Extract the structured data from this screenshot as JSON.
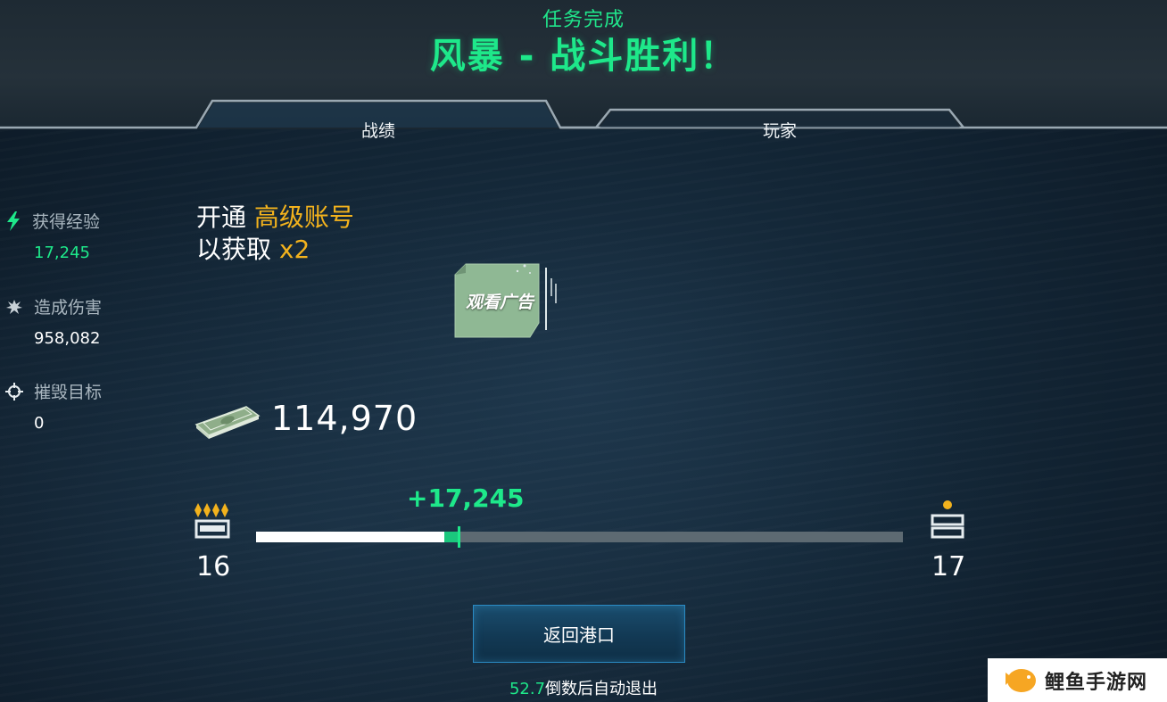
{
  "header": {
    "subtitle": "任务完成",
    "title": "风暴 - 战斗胜利！"
  },
  "tabs": [
    {
      "label": "战绩",
      "active": true
    },
    {
      "label": "玩家",
      "active": false
    }
  ],
  "stats": [
    {
      "label": "获得经验",
      "value": "17,245",
      "icon": "lightning-icon",
      "value_color": "#1ee88a"
    },
    {
      "label": "造成伤害",
      "value": "958,082",
      "icon": "explosion-icon",
      "value_color": "#ffffff"
    },
    {
      "label": "摧毁目标",
      "value": "0",
      "icon": "crosshair-icon",
      "value_color": "#ffffff"
    }
  ],
  "promo": {
    "prefix": "开通 ",
    "highlight": "高级账号",
    "line2_prefix": "以获取 ",
    "multiplier": "x2"
  },
  "ad_button": {
    "label": "观看广告"
  },
  "reward": {
    "amount": "114,970",
    "icon": "money-stack-icon"
  },
  "progress": {
    "gain_label": "+17,245",
    "current_level": "16",
    "next_level": "17",
    "previous_fraction": 0.291,
    "total_fraction": 0.313
  },
  "return_button": {
    "label": "返回港口"
  },
  "countdown": {
    "seconds": "52.7",
    "suffix": "倒数后自动退出"
  },
  "watermark": {
    "text": "鲤鱼手游网"
  },
  "colors": {
    "accent_green": "#1ee88a",
    "gold": "#f2b21d",
    "button_border": "#2a8bc4"
  }
}
